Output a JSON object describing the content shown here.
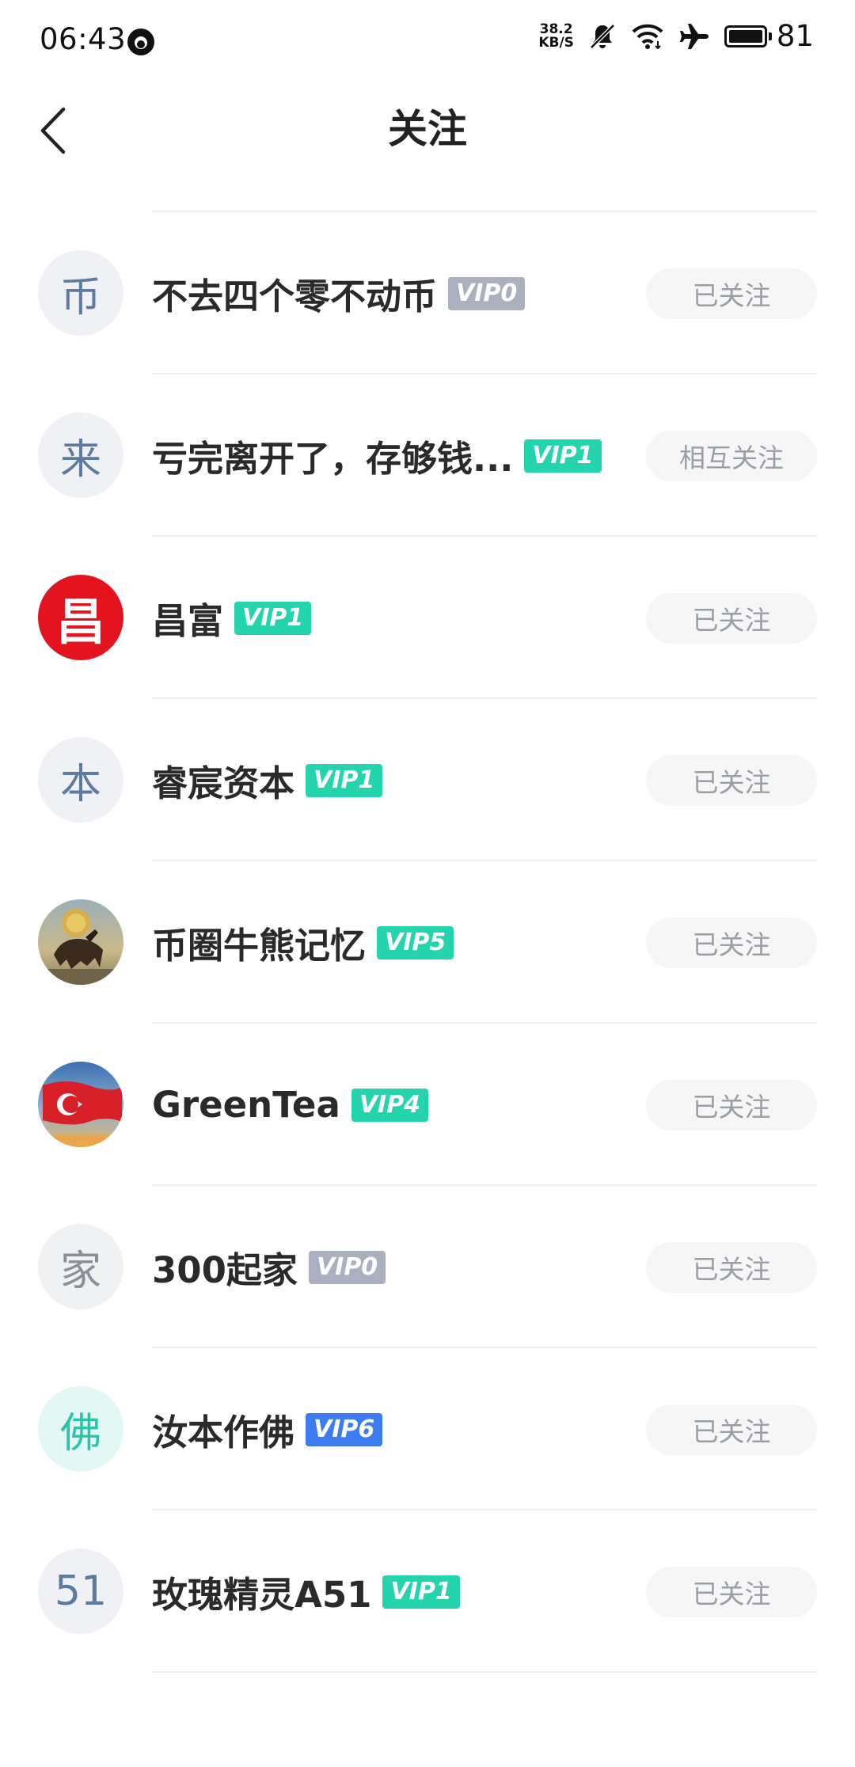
{
  "status_bar": {
    "time": "06:43",
    "net_speed_value": "38.2",
    "net_speed_unit": "KB/S",
    "battery": "81",
    "icons": [
      "notification-indicator-icon",
      "mute-bell-icon",
      "wifi-icon",
      "airplane-icon",
      "battery-icon"
    ]
  },
  "header": {
    "title": "关注",
    "back_icon": "chevron-left-icon"
  },
  "colors": {
    "vip_gray": "#aab0bd",
    "vip_green": "#23d4ad",
    "vip_blue": "#3b7df0",
    "follow_button_bg": "#f6f6f7",
    "follow_button_text": "#9a9ea6"
  },
  "follows": [
    {
      "avatar_text": "币",
      "name": "不去四个零不动币",
      "vip": "VIP0",
      "status": "已关注"
    },
    {
      "avatar_text": "来",
      "name": "亏完离开了，存够钱...",
      "vip": "VIP1",
      "status": "相互关注"
    },
    {
      "avatar_text": "昌",
      "name": "昌富",
      "vip": "VIP1",
      "status": "已关注"
    },
    {
      "avatar_text": "本",
      "name": "睿宸资本",
      "vip": "VIP1",
      "status": "已关注"
    },
    {
      "avatar_text": "",
      "name": "币圈牛熊记忆",
      "vip": "VIP5",
      "status": "已关注"
    },
    {
      "avatar_text": "",
      "name": "GreenTea",
      "vip": "VIP4",
      "status": "已关注"
    },
    {
      "avatar_text": "家",
      "name": "300起家",
      "vip": "VIP0",
      "status": "已关注"
    },
    {
      "avatar_text": "佛",
      "name": "汝本作佛",
      "vip": "VIP6",
      "status": "已关注"
    },
    {
      "avatar_text": "51",
      "name": "玫瑰精灵A51",
      "vip": "VIP1",
      "status": "已关注"
    }
  ]
}
